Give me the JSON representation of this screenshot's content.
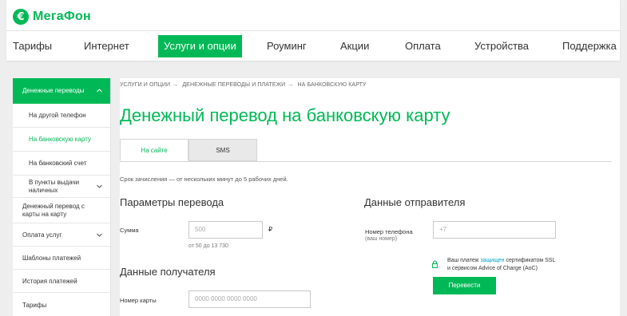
{
  "header": {
    "logo_symbol": "€",
    "logo_text": "МегаФон",
    "brand_color": "#00b956",
    "nav": [
      {
        "label": "Тарифы",
        "active": false
      },
      {
        "label": "Интернет",
        "active": false
      },
      {
        "label": "Услуги и опции",
        "active": true
      },
      {
        "label": "Роуминг",
        "active": false
      },
      {
        "label": "Акции",
        "active": false
      },
      {
        "label": "Оплата",
        "active": false
      },
      {
        "label": "Устройства",
        "active": false
      },
      {
        "label": "Поддержка",
        "active": false
      }
    ]
  },
  "sidebar": {
    "items": [
      {
        "label": "Денежные переводы",
        "state": "expanded",
        "icon": "chevron-up-icon"
      },
      {
        "label": "На другой телефон"
      },
      {
        "label": "На банковскую карту",
        "state": "selected"
      },
      {
        "label": "На банковский счет"
      },
      {
        "label": "В пункты выдачи наличных",
        "icon": "chevron-down-icon"
      },
      {
        "label": "Денежный перевод с карты на карту"
      },
      {
        "label": "Оплата услуг",
        "icon": "chevron-down-icon"
      },
      {
        "label": "Шаблоны платежей"
      },
      {
        "label": "История платежей"
      },
      {
        "label": "Тарифы"
      }
    ]
  },
  "breadcrumb": {
    "items": [
      "УСЛУГИ И ОПЦИИ",
      "ДЕНЕЖНЫЕ ПЕРЕВОДЫ И ПЛАТЕЖИ",
      "НА БАНКОВСКУЮ КАРТУ"
    ],
    "separator": "→"
  },
  "page_title": "Денежный перевод на банковскую карту",
  "tabs": [
    {
      "label": "На сайте",
      "active": true
    },
    {
      "label": "SMS",
      "active": false
    }
  ],
  "note": "Срок зачисления — от нескольких минут до 5 рабочих дней.",
  "transfer": {
    "heading": "Параметры перевода",
    "amount_label": "Сумма",
    "amount_placeholder": "500",
    "currency": "₽",
    "amount_hint": "от 50 до 13 730"
  },
  "recipient": {
    "heading": "Данные получателя",
    "card_label": "Номер карты",
    "card_placeholder": "0000 0000 0000 0000"
  },
  "sender": {
    "heading": "Данные отправителя",
    "phone_label": "Номер телефона",
    "phone_hint": "(ваш номер)",
    "phone_placeholder": "+7",
    "secure_prefix": "Ваш платеж ",
    "secure_link": "защищен",
    "secure_suffix": " сертификатом SSL",
    "secure_line2": "и сервисом Advice of Charge (AoC)",
    "lock_icon": "lock-icon",
    "submit_label": "Перевести"
  }
}
